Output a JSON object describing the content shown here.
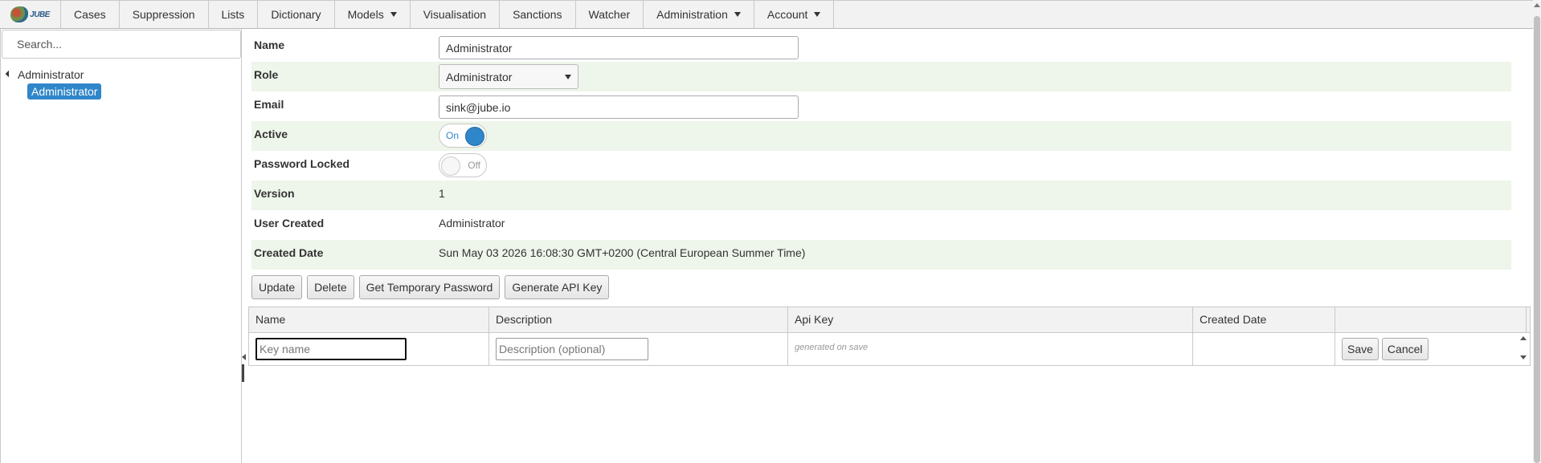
{
  "nav": {
    "logo_text": "JUBE",
    "items": [
      {
        "label": "Cases",
        "dropdown": false
      },
      {
        "label": "Suppression",
        "dropdown": false
      },
      {
        "label": "Lists",
        "dropdown": false
      },
      {
        "label": "Dictionary",
        "dropdown": false
      },
      {
        "label": "Models",
        "dropdown": true
      },
      {
        "label": "Visualisation",
        "dropdown": false
      },
      {
        "label": "Sanctions",
        "dropdown": false
      },
      {
        "label": "Watcher",
        "dropdown": false
      },
      {
        "label": "Administration",
        "dropdown": true
      },
      {
        "label": "Account",
        "dropdown": true
      }
    ]
  },
  "sidebar": {
    "search_placeholder": "Search...",
    "tree_root": "Administrator",
    "tree_child": "Administrator"
  },
  "form": {
    "name_label": "Name",
    "name_value": "Administrator",
    "role_label": "Role",
    "role_value": "Administrator",
    "email_label": "Email",
    "email_value": "sink@jube.io",
    "active_label": "Active",
    "active_state": "On",
    "password_locked_label": "Password Locked",
    "password_locked_state": "Off",
    "version_label": "Version",
    "version_value": "1",
    "user_created_label": "User Created",
    "user_created_value": "Administrator",
    "created_date_label": "Created Date",
    "created_date_value": "Sun May 03 2026 16:08:30 GMT+0200 (Central European Summer Time)"
  },
  "actions": {
    "update": "Update",
    "delete": "Delete",
    "temp_password": "Get Temporary Password",
    "generate_api_key": "Generate API Key"
  },
  "api_keys_grid": {
    "columns": [
      "Name",
      "Description",
      "Api Key",
      "Created Date",
      ""
    ],
    "new_row": {
      "name_placeholder": "Key name",
      "description_placeholder": "Description (optional)",
      "api_key_placeholder": "generated on save",
      "save": "Save",
      "cancel": "Cancel"
    }
  },
  "colors": {
    "accent": "#2f86c9",
    "alt_row": "#eef5ea",
    "nav_bg": "#f2f2f2"
  }
}
